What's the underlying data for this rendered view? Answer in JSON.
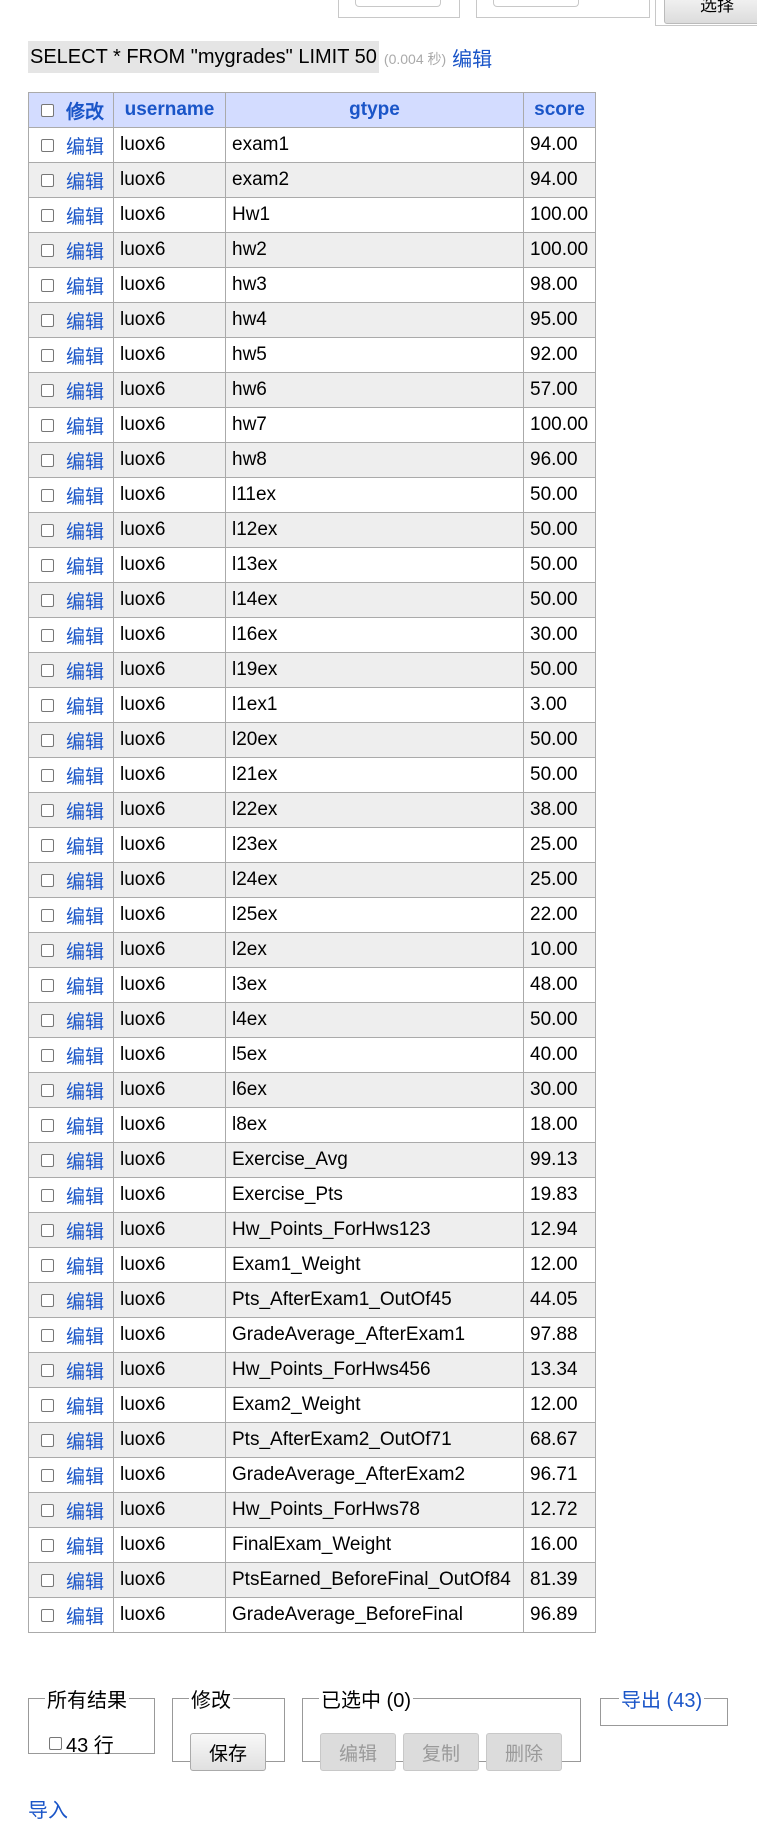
{
  "top": {
    "choose_button": "选择"
  },
  "query": {
    "sql": "SELECT * FROM \"mygrades\" LIMIT 50",
    "time": "(0.004 秒)",
    "edit_link": "编辑"
  },
  "table": {
    "columns": [
      "修改",
      "username",
      "gtype",
      "score"
    ],
    "edit_label": "编辑",
    "rows": [
      {
        "username": "luox6",
        "gtype": "exam1",
        "score": "94.00"
      },
      {
        "username": "luox6",
        "gtype": "exam2",
        "score": "94.00"
      },
      {
        "username": "luox6",
        "gtype": "Hw1",
        "score": "100.00"
      },
      {
        "username": "luox6",
        "gtype": "hw2",
        "score": "100.00"
      },
      {
        "username": "luox6",
        "gtype": "hw3",
        "score": "98.00"
      },
      {
        "username": "luox6",
        "gtype": "hw4",
        "score": "95.00"
      },
      {
        "username": "luox6",
        "gtype": "hw5",
        "score": "92.00"
      },
      {
        "username": "luox6",
        "gtype": "hw6",
        "score": "57.00"
      },
      {
        "username": "luox6",
        "gtype": "hw7",
        "score": "100.00"
      },
      {
        "username": "luox6",
        "gtype": "hw8",
        "score": "96.00"
      },
      {
        "username": "luox6",
        "gtype": "l11ex",
        "score": "50.00"
      },
      {
        "username": "luox6",
        "gtype": "l12ex",
        "score": "50.00"
      },
      {
        "username": "luox6",
        "gtype": "l13ex",
        "score": "50.00"
      },
      {
        "username": "luox6",
        "gtype": "l14ex",
        "score": "50.00"
      },
      {
        "username": "luox6",
        "gtype": "l16ex",
        "score": "30.00"
      },
      {
        "username": "luox6",
        "gtype": "l19ex",
        "score": "50.00"
      },
      {
        "username": "luox6",
        "gtype": "l1ex1",
        "score": "3.00"
      },
      {
        "username": "luox6",
        "gtype": "l20ex",
        "score": "50.00"
      },
      {
        "username": "luox6",
        "gtype": "l21ex",
        "score": "50.00"
      },
      {
        "username": "luox6",
        "gtype": "l22ex",
        "score": "38.00"
      },
      {
        "username": "luox6",
        "gtype": "l23ex",
        "score": "25.00"
      },
      {
        "username": "luox6",
        "gtype": "l24ex",
        "score": "25.00"
      },
      {
        "username": "luox6",
        "gtype": "l25ex",
        "score": "22.00"
      },
      {
        "username": "luox6",
        "gtype": "l2ex",
        "score": "10.00"
      },
      {
        "username": "luox6",
        "gtype": "l3ex",
        "score": "48.00"
      },
      {
        "username": "luox6",
        "gtype": "l4ex",
        "score": "50.00"
      },
      {
        "username": "luox6",
        "gtype": "l5ex",
        "score": "40.00"
      },
      {
        "username": "luox6",
        "gtype": "l6ex",
        "score": "30.00"
      },
      {
        "username": "luox6",
        "gtype": "l8ex",
        "score": "18.00"
      },
      {
        "username": "luox6",
        "gtype": "Exercise_Avg",
        "score": "99.13"
      },
      {
        "username": "luox6",
        "gtype": "Exercise_Pts",
        "score": "19.83"
      },
      {
        "username": "luox6",
        "gtype": "Hw_Points_ForHws123",
        "score": "12.94"
      },
      {
        "username": "luox6",
        "gtype": "Exam1_Weight",
        "score": "12.00"
      },
      {
        "username": "luox6",
        "gtype": "Pts_AfterExam1_OutOf45",
        "score": "44.05"
      },
      {
        "username": "luox6",
        "gtype": "GradeAverage_AfterExam1",
        "score": "97.88"
      },
      {
        "username": "luox6",
        "gtype": "Hw_Points_ForHws456",
        "score": "13.34"
      },
      {
        "username": "luox6",
        "gtype": "Exam2_Weight",
        "score": "12.00"
      },
      {
        "username": "luox6",
        "gtype": "Pts_AfterExam2_OutOf71",
        "score": "68.67"
      },
      {
        "username": "luox6",
        "gtype": "GradeAverage_AfterExam2",
        "score": "96.71"
      },
      {
        "username": "luox6",
        "gtype": "Hw_Points_ForHws78",
        "score": "12.72"
      },
      {
        "username": "luox6",
        "gtype": "FinalExam_Weight",
        "score": "16.00"
      },
      {
        "username": "luox6",
        "gtype": "PtsEarned_BeforeFinal_OutOf84",
        "score": "81.39"
      },
      {
        "username": "luox6",
        "gtype": "GradeAverage_BeforeFinal",
        "score": "96.89"
      }
    ]
  },
  "footer": {
    "all_results": {
      "legend": "所有结果",
      "count": "43 行"
    },
    "modify": {
      "legend": "修改",
      "save": "保存"
    },
    "selected": {
      "legend": "已选中 (0)",
      "edit": "编辑",
      "copy": "复制",
      "delete": "删除"
    },
    "export": {
      "legend": "导出 (43)"
    },
    "import": "导入"
  }
}
